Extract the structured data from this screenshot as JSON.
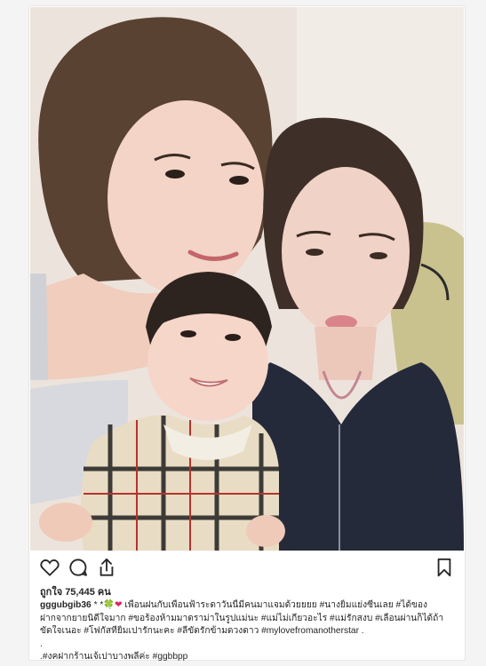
{
  "post": {
    "image_alt": "Selfie of two women and a toddler",
    "likes_label": "ถูกใจ 75,445 คน",
    "caption": {
      "username": "gggubgib36",
      "stars": " * *",
      "emoji_clover": "🍀",
      "emoji_heart": "❤",
      "line1_text": " เพื่อนฝนกับเพื่อนฟ้าระดาวันนี้มีคนมาแจมด้วยยยย #นางยิ้มแย่งซีนเลย #ได้ของ",
      "line2_text": "ฝากจากยายนิดีใจมาก #ขอร้องห้ามมาดราม่าในรูปแม่นะ #แม่ไม่เกี่ยวอะไร #แม่รักสงบ #เลื่อนผ่านก็ได้ถ้า",
      "line3_text": "ขัดใจเนอะ #โฟกัสที่ยิ้มเปารักนะคะ #ลีขัดรักข้ามดวงดาว #mylovefromanotherstar .",
      "line4_text": ".",
      "line5_text": ".#งคฝากร้านเจ้เปาบางพลีค่ะ #ggbbpp"
    },
    "icons": {
      "like": "heart-outline-icon",
      "comment": "comment-bubble-icon",
      "share": "share-upload-icon",
      "save": "bookmark-icon"
    }
  },
  "colors": {
    "text": "#262626",
    "border": "#e6e6e6",
    "page_bg": "#f4f4f4"
  }
}
